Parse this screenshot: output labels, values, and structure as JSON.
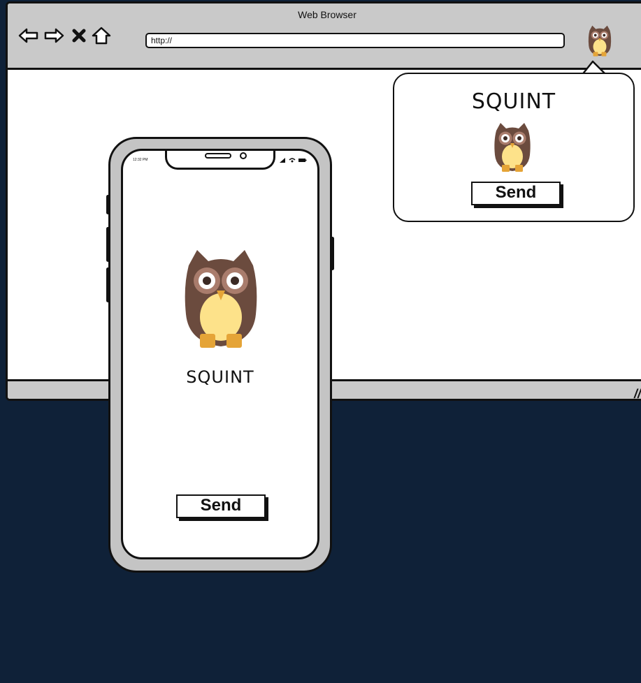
{
  "browser": {
    "title": "Web Browser",
    "url": "http://",
    "nav_icons": [
      "back-arrow-icon",
      "forward-arrow-icon",
      "close-icon",
      "home-icon"
    ],
    "toolbar_extension_icon": "owl-icon"
  },
  "popup": {
    "title": "SQUINT",
    "icon": "owl-icon",
    "send_label": "Send"
  },
  "phone": {
    "status_time": "12:32 PM",
    "app_title": "SQUINT",
    "app_icon": "owl-icon",
    "send_label": "Send"
  },
  "colors": {
    "background": "#0f2138",
    "chrome_gray": "#c9c9c9",
    "owl_brown": "#6b4b3e",
    "owl_belly": "#fde28a",
    "owl_feet": "#e5a437"
  }
}
